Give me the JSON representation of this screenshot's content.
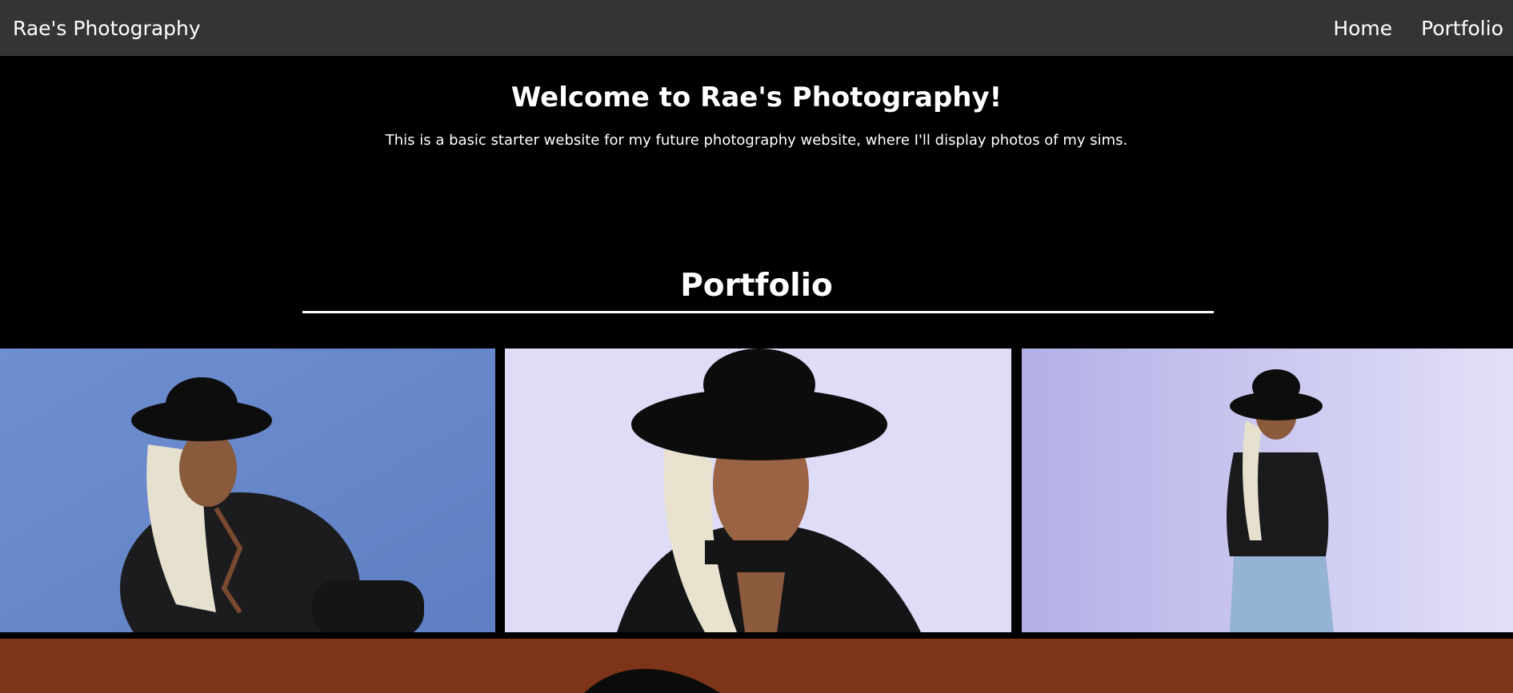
{
  "navbar": {
    "brand": "Rae's Photography",
    "links": [
      {
        "label": "Home"
      },
      {
        "label": "Portfolio"
      }
    ]
  },
  "hero": {
    "title": "Welcome to Rae's Photography!",
    "text": "This is a basic starter website for my future photography website, where I'll display photos of my sims."
  },
  "portfolio": {
    "title": "Portfolio"
  },
  "colors": {
    "navbar_bg": "#343434",
    "page_bg": "#000000",
    "photo1_bg": "#6b8ccc",
    "photo2_bg": "#dcdaf6",
    "photo3_bg": "#c8c6ee",
    "photo4_bg": "#7d3418"
  }
}
